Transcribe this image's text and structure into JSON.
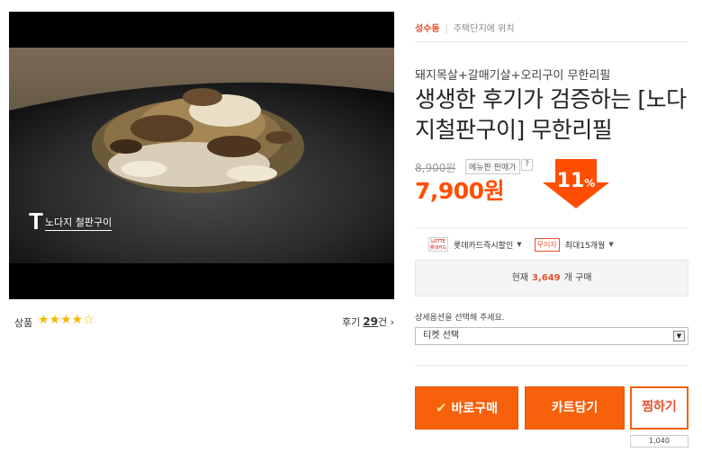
{
  "media": {
    "watermark_letter": "T",
    "watermark_caption": "노다지 철판구이"
  },
  "rating": {
    "label": "상품",
    "stars_filled": 4,
    "stars_total": 5,
    "star_full": "★★★★",
    "star_empty": "☆",
    "reviews_label": "후기",
    "reviews_count": "29",
    "reviews_unit": "건",
    "reviews_arrow": "›"
  },
  "breadcrumb": {
    "location": "성수동",
    "category": "주택단지에 위치"
  },
  "product": {
    "subtitle": "돼지목살+갈매기살+오리구이 무한리필",
    "title": "생생한 후기가 검증하는 [노다지철판구이] 무한리필"
  },
  "price": {
    "original": "8,900원",
    "tag": "메뉴판 판매가",
    "help": "?",
    "current": "7,900원",
    "discount_number": "11",
    "discount_unit": "%"
  },
  "cards": {
    "lotte_logo_text": "LOTTE 롯데카드",
    "lotte_label": "롯데카드즉시할인",
    "installment_badge": "무이자",
    "installment_label": "최대15개월"
  },
  "purchase_status": {
    "prefix": "현재",
    "count": "3,649",
    "suffix": "개 구매"
  },
  "options": {
    "label": "상세옵션을 선택해 주세요.",
    "selected": "티켓 선택"
  },
  "buttons": {
    "buy": "바로구매",
    "buy_check": "✔",
    "cart": "카트담기",
    "wish": "찜하기",
    "wish_count": "1,040"
  },
  "colors": {
    "accent": "#f7610c",
    "price_red": "#ff4e00",
    "star": "#f5b800"
  }
}
